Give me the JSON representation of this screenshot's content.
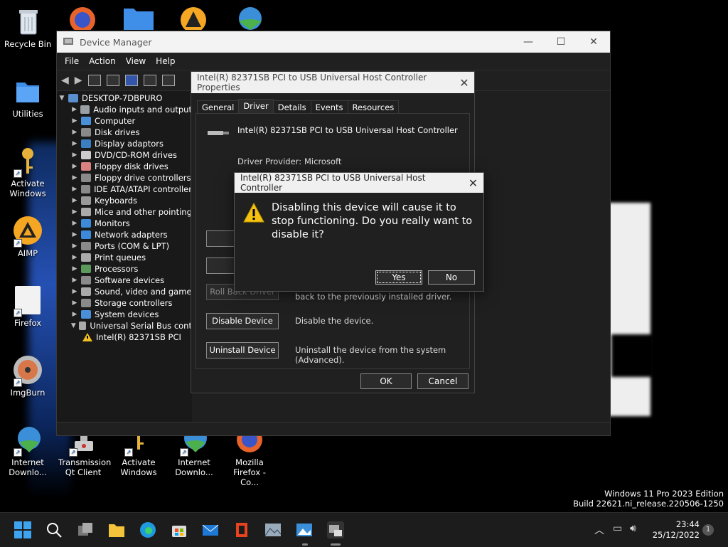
{
  "desktop_icons": [
    {
      "label": "Recycle Bin"
    },
    {
      "label": "Utilities"
    },
    {
      "label": "Activate Windows"
    },
    {
      "label": "AIMP"
    },
    {
      "label": "Firefox"
    },
    {
      "label": "ImgBurn"
    },
    {
      "label": "Internet Downlo..."
    },
    {
      "label": "Transmission Qt Client"
    },
    {
      "label": "Activate Windows"
    },
    {
      "label": "Internet Downlo..."
    },
    {
      "label": "Mozilla Firefox - Co..."
    }
  ],
  "device_manager": {
    "title": "Device Manager",
    "menu": [
      "File",
      "Action",
      "View",
      "Help"
    ],
    "root": "DESKTOP-7DBPURO",
    "tree": [
      {
        "label": "Audio inputs and output",
        "color": "#9aa0a6"
      },
      {
        "label": "Computer",
        "color": "#4a90d9"
      },
      {
        "label": "Disk drives",
        "color": "#8a8a8a"
      },
      {
        "label": "Display adaptors",
        "color": "#3c7fc0"
      },
      {
        "label": "DVD/CD-ROM drives",
        "color": "#cccccc"
      },
      {
        "label": "Floppy disk drives",
        "color": "#d98080"
      },
      {
        "label": "Floppy drive controllers",
        "color": "#8a8a8a"
      },
      {
        "label": "IDE ATA/ATAPI controller",
        "color": "#8a8a8a"
      },
      {
        "label": "Keyboards",
        "color": "#999999"
      },
      {
        "label": "Mice and other pointing",
        "color": "#aaaaaa"
      },
      {
        "label": "Monitors",
        "color": "#3c8ad9"
      },
      {
        "label": "Network adapters",
        "color": "#3c8ad9"
      },
      {
        "label": "Ports (COM & LPT)",
        "color": "#8a8a8a"
      },
      {
        "label": "Print queues",
        "color": "#aaaaaa"
      },
      {
        "label": "Processors",
        "color": "#5a9a5a"
      },
      {
        "label": "Software devices",
        "color": "#8a8a8a"
      },
      {
        "label": "Sound, video and game",
        "color": "#aaaaaa"
      },
      {
        "label": "Storage controllers",
        "color": "#8a8a8a"
      },
      {
        "label": "System devices",
        "color": "#4a90d9"
      },
      {
        "label": "Universal Serial Bus cont",
        "color": "#aaaaaa"
      }
    ],
    "usb_child": "Intel(R) 82371SB PCI"
  },
  "properties": {
    "title": "Intel(R) 82371SB PCI to USB Universal Host Controller Properties",
    "tabs": [
      "General",
      "Driver",
      "Details",
      "Events",
      "Resources"
    ],
    "device_name": "Intel(R) 82371SB PCI to USB Universal Host Controller",
    "provider_label": "Driver Provider:",
    "provider_value": "Microsoft",
    "btn_driver": "Driv",
    "btn_update": "Upd",
    "btn_rollback": "Roll Back Driver",
    "rollback_desc": "back to the previously installed driver.",
    "btn_disable": "Disable Device",
    "disable_desc": "Disable the device.",
    "btn_uninstall": "Uninstall Device",
    "uninstall_desc": "Uninstall the device from the system (Advanced).",
    "ok": "OK",
    "cancel": "Cancel"
  },
  "confirm": {
    "title": "Intel(R) 82371SB PCI to USB Universal Host Controller",
    "message": "Disabling this device will cause it to stop functioning. Do you really want to disable it?",
    "yes": "Yes",
    "no": "No"
  },
  "watermark": {
    "line1": "Windows 11 Pro 2023 Edition",
    "line2": "Build 22621.ni_release.220506-1250"
  },
  "clock": {
    "time": "23:44",
    "date": "25/12/2022"
  },
  "notification_count": "1",
  "taskbar_icons": [
    "start-icon",
    "search-icon",
    "task-view-icon",
    "file-explorer-icon",
    "edge-icon",
    "store-icon",
    "mail-icon",
    "office-icon",
    "photos-icon",
    "image-viewer-icon",
    "device-manager-icon"
  ]
}
